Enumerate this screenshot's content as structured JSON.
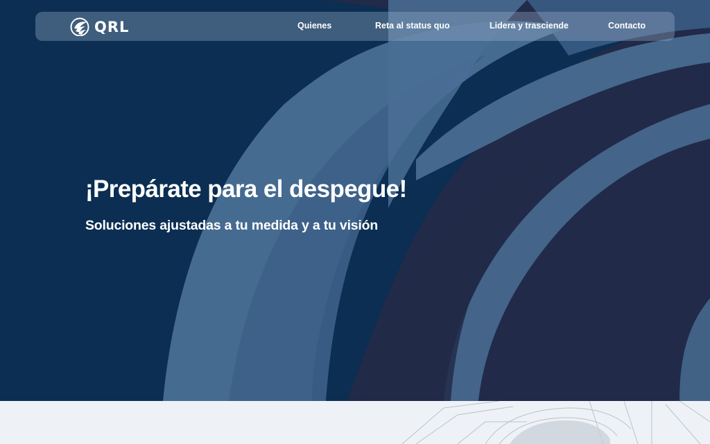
{
  "brand": {
    "name": "QRL",
    "logo_icon": "eagle-emblem-icon"
  },
  "nav": {
    "items": [
      {
        "label": "Quienes"
      },
      {
        "label": "Reta al status quo"
      },
      {
        "label": "Lidera y trasciende"
      },
      {
        "label": "Contacto"
      }
    ]
  },
  "hero": {
    "title": "¡Prepárate para el despegue!",
    "subtitle": "Soluciones ajustadas a tu medida y a tu visión"
  },
  "colors": {
    "hero_dark": "#0b2e52",
    "hero_navy": "#212a48",
    "brush_stroke": "#4a6f95",
    "lower_bg": "#eef2f6",
    "text": "#ffffff"
  }
}
